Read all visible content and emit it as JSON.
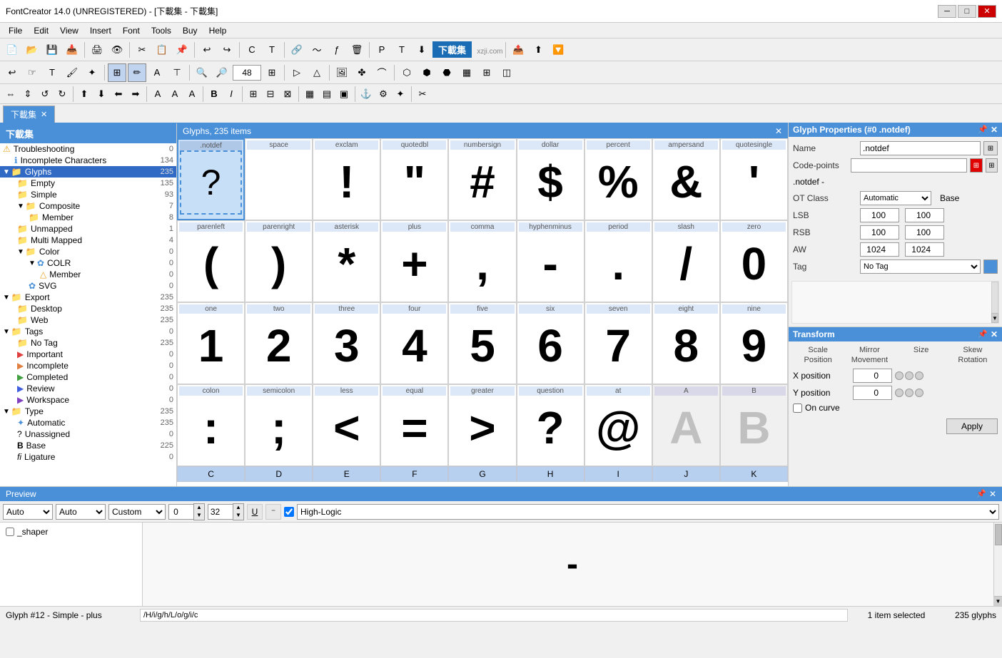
{
  "titleBar": {
    "title": "FontCreator 14.0 (UNREGISTERED) - [下載集 - 下載集]",
    "winButtons": [
      "─",
      "□",
      "✕"
    ]
  },
  "menuBar": {
    "items": [
      "File",
      "Edit",
      "View",
      "Insert",
      "Font",
      "Tools",
      "Buy",
      "Help"
    ]
  },
  "tab": {
    "label": "下載集",
    "closeBtn": "✕"
  },
  "glyphHeader": {
    "title": "Glyphs, 235 items",
    "closeBtn": "✕"
  },
  "sidebar": {
    "title": "下載集",
    "items": [
      {
        "label": "Troubleshooting",
        "count": "0",
        "level": 1,
        "icon": "⚠",
        "type": "warning"
      },
      {
        "label": "Incomplete Characters",
        "count": "134",
        "level": 2,
        "icon": "ℹ",
        "type": "info"
      },
      {
        "label": "Glyphs",
        "count": "235",
        "level": 1,
        "icon": "▼",
        "type": "folder",
        "expanded": true
      },
      {
        "label": "Empty",
        "count": "135",
        "level": 2,
        "icon": "📁",
        "type": "folder"
      },
      {
        "label": "Simple",
        "count": "93",
        "level": 2,
        "icon": "📁",
        "type": "folder"
      },
      {
        "label": "Composite",
        "count": "7",
        "level": 2,
        "icon": "▼",
        "type": "folder-open"
      },
      {
        "label": "Member",
        "count": "8",
        "level": 3,
        "icon": "📁",
        "type": "folder"
      },
      {
        "label": "Unmapped",
        "count": "1",
        "level": 2,
        "icon": "📁",
        "type": "folder"
      },
      {
        "label": "Multi Mapped",
        "count": "4",
        "level": 2,
        "icon": "📁",
        "type": "folder"
      },
      {
        "label": "Color",
        "count": "0",
        "level": 2,
        "icon": "▼",
        "type": "folder-open"
      },
      {
        "label": "COLR",
        "count": "0",
        "level": 3,
        "icon": "▼",
        "type": "folder-open"
      },
      {
        "label": "Member",
        "count": "0",
        "level": 4,
        "icon": "△",
        "type": "member"
      },
      {
        "label": "SVG",
        "count": "0",
        "level": 3,
        "icon": "✿",
        "type": "svg"
      },
      {
        "label": "Export",
        "count": "235",
        "level": 1,
        "icon": "▼",
        "type": "folder-open"
      },
      {
        "label": "Desktop",
        "count": "235",
        "level": 2,
        "icon": "📁",
        "type": "folder"
      },
      {
        "label": "Web",
        "count": "235",
        "level": 2,
        "icon": "📁",
        "type": "folder"
      },
      {
        "label": "Tags",
        "count": "0",
        "level": 1,
        "icon": "▼",
        "type": "folder-open"
      },
      {
        "label": "No Tag",
        "count": "235",
        "level": 2,
        "icon": "📁",
        "type": "folder"
      },
      {
        "label": "Important",
        "count": "0",
        "level": 2,
        "icon": "▶",
        "type": "tag"
      },
      {
        "label": "Incomplete",
        "count": "0",
        "level": 2,
        "icon": "▶",
        "type": "tag"
      },
      {
        "label": "Completed",
        "count": "0",
        "level": 2,
        "icon": "▶",
        "type": "tag"
      },
      {
        "label": "Review",
        "count": "0",
        "level": 2,
        "icon": "▶",
        "type": "tag"
      },
      {
        "label": "Workspace",
        "count": "0",
        "level": 2,
        "icon": "▶",
        "type": "tag"
      },
      {
        "label": "Type",
        "count": "235",
        "level": 1,
        "icon": "▼",
        "type": "folder-open"
      },
      {
        "label": "Automatic",
        "count": "235",
        "level": 2,
        "icon": "✦",
        "type": "auto"
      },
      {
        "label": "Unassigned",
        "count": "0",
        "level": 2,
        "icon": "?",
        "type": "unassigned"
      },
      {
        "label": "Base",
        "count": "225",
        "level": 2,
        "icon": "B",
        "type": "base"
      },
      {
        "label": "Ligature",
        "count": "0",
        "level": 2,
        "icon": "fi",
        "type": "ligature"
      }
    ]
  },
  "glyphs": {
    "row1": [
      {
        "name": ".notdef",
        "char": "?",
        "selected": true,
        "bordered": true
      },
      {
        "name": "space",
        "char": ""
      },
      {
        "name": "exclam",
        "char": "!"
      },
      {
        "name": "quotedbl",
        "char": "\""
      },
      {
        "name": "numbersign",
        "char": "#"
      },
      {
        "name": "dollar",
        "char": "$"
      },
      {
        "name": "percent",
        "char": "%"
      },
      {
        "name": "ampersand",
        "char": "&"
      },
      {
        "name": "quotesingle",
        "char": "'"
      }
    ],
    "row2": [
      {
        "name": "parenleft",
        "char": "("
      },
      {
        "name": "parenright",
        "char": ")"
      },
      {
        "name": "asterisk",
        "char": "*"
      },
      {
        "name": "plus",
        "char": "+"
      },
      {
        "name": "comma",
        "char": ","
      },
      {
        "name": "hyphenminus",
        "char": "-"
      },
      {
        "name": "period",
        "char": "."
      },
      {
        "name": "slash",
        "char": "/"
      },
      {
        "name": "zero",
        "char": "0"
      }
    ],
    "row3": [
      {
        "name": "one",
        "char": "1"
      },
      {
        "name": "two",
        "char": "2"
      },
      {
        "name": "three",
        "char": "3"
      },
      {
        "name": "four",
        "char": "4"
      },
      {
        "name": "five",
        "char": "5"
      },
      {
        "name": "six",
        "char": "6"
      },
      {
        "name": "seven",
        "char": "7"
      },
      {
        "name": "eight",
        "char": "8"
      },
      {
        "name": "nine",
        "char": "9"
      }
    ],
    "row4": [
      {
        "name": "colon",
        "char": ":"
      },
      {
        "name": "semicolon",
        "char": ";"
      },
      {
        "name": "less",
        "char": "<"
      },
      {
        "name": "equal",
        "char": "="
      },
      {
        "name": "greater",
        "char": ">"
      },
      {
        "name": "question",
        "char": "?"
      },
      {
        "name": "at",
        "char": "@"
      },
      {
        "name": "A",
        "char": "A",
        "light": true
      },
      {
        "name": "B",
        "char": "B",
        "light": true
      }
    ],
    "row5header": [
      {
        "name": "C"
      },
      {
        "name": "D"
      },
      {
        "name": "E"
      },
      {
        "name": "F"
      },
      {
        "name": "G"
      },
      {
        "name": "H"
      },
      {
        "name": "I"
      },
      {
        "name": "J"
      },
      {
        "name": "K"
      }
    ]
  },
  "glyphProps": {
    "panelTitle": "Glyph Properties (#0 .notdef)",
    "pinBtn": "📌",
    "closeBtn": "✕",
    "nameLabel": "Name",
    "nameValue": ".notdef",
    "codePointsLabel": "Code-points",
    "codePointsValue": "",
    "notdefLabel": ".notdef -",
    "otClassLabel": "OT Class",
    "otClassValue": "Automatic",
    "baseLabel": "Base",
    "lsbLabel": "LSB",
    "lsbValue": "100",
    "lsbValue2": "100",
    "rsbLabel": "RSB",
    "rsbValue": "100",
    "rsbValue2": "100",
    "awLabel": "AW",
    "awValue": "1024",
    "awValue2": "1024",
    "tagLabel": "Tag",
    "tagValue": "No Tag"
  },
  "transform": {
    "panelTitle": "Transform",
    "pinBtn": "📌",
    "closeBtn": "✕",
    "labels": [
      "Scale",
      "Mirror",
      "Size",
      "Skew",
      "Position",
      "Movement",
      "",
      "Rotation"
    ],
    "xPositionLabel": "X position",
    "xPositionValue": "0",
    "yPositionLabel": "Y position",
    "yPositionValue": "0",
    "onCurveLabel": "On curve",
    "applyBtn": "Apply"
  },
  "preview": {
    "panelTitle": "Preview",
    "pinBtn": "📌",
    "closeBtn": "✕",
    "autoOption1": "Auto",
    "autoOption2": "Auto",
    "customLabel": "Custom",
    "value1": "0",
    "value2": "32",
    "checkboxChecked": true,
    "engineValue": "High-Logic",
    "shaperLabel": "_shaper",
    "previewText": "-",
    "pathText": "/H/i/g/h/L/o/g/i/c"
  },
  "statusBar": {
    "glyphInfo": "Glyph #12 - Simple - plus",
    "selectionInfo": "1 item selected",
    "totalGlyphs": "235 glyphs"
  },
  "colors": {
    "accent": "#4a90d9",
    "headerBg": "#4a90d9",
    "selectedBg": "#316ac5",
    "rowHeaderBg": "#b8d0f0",
    "glyphBg": "#e8f0fe"
  }
}
